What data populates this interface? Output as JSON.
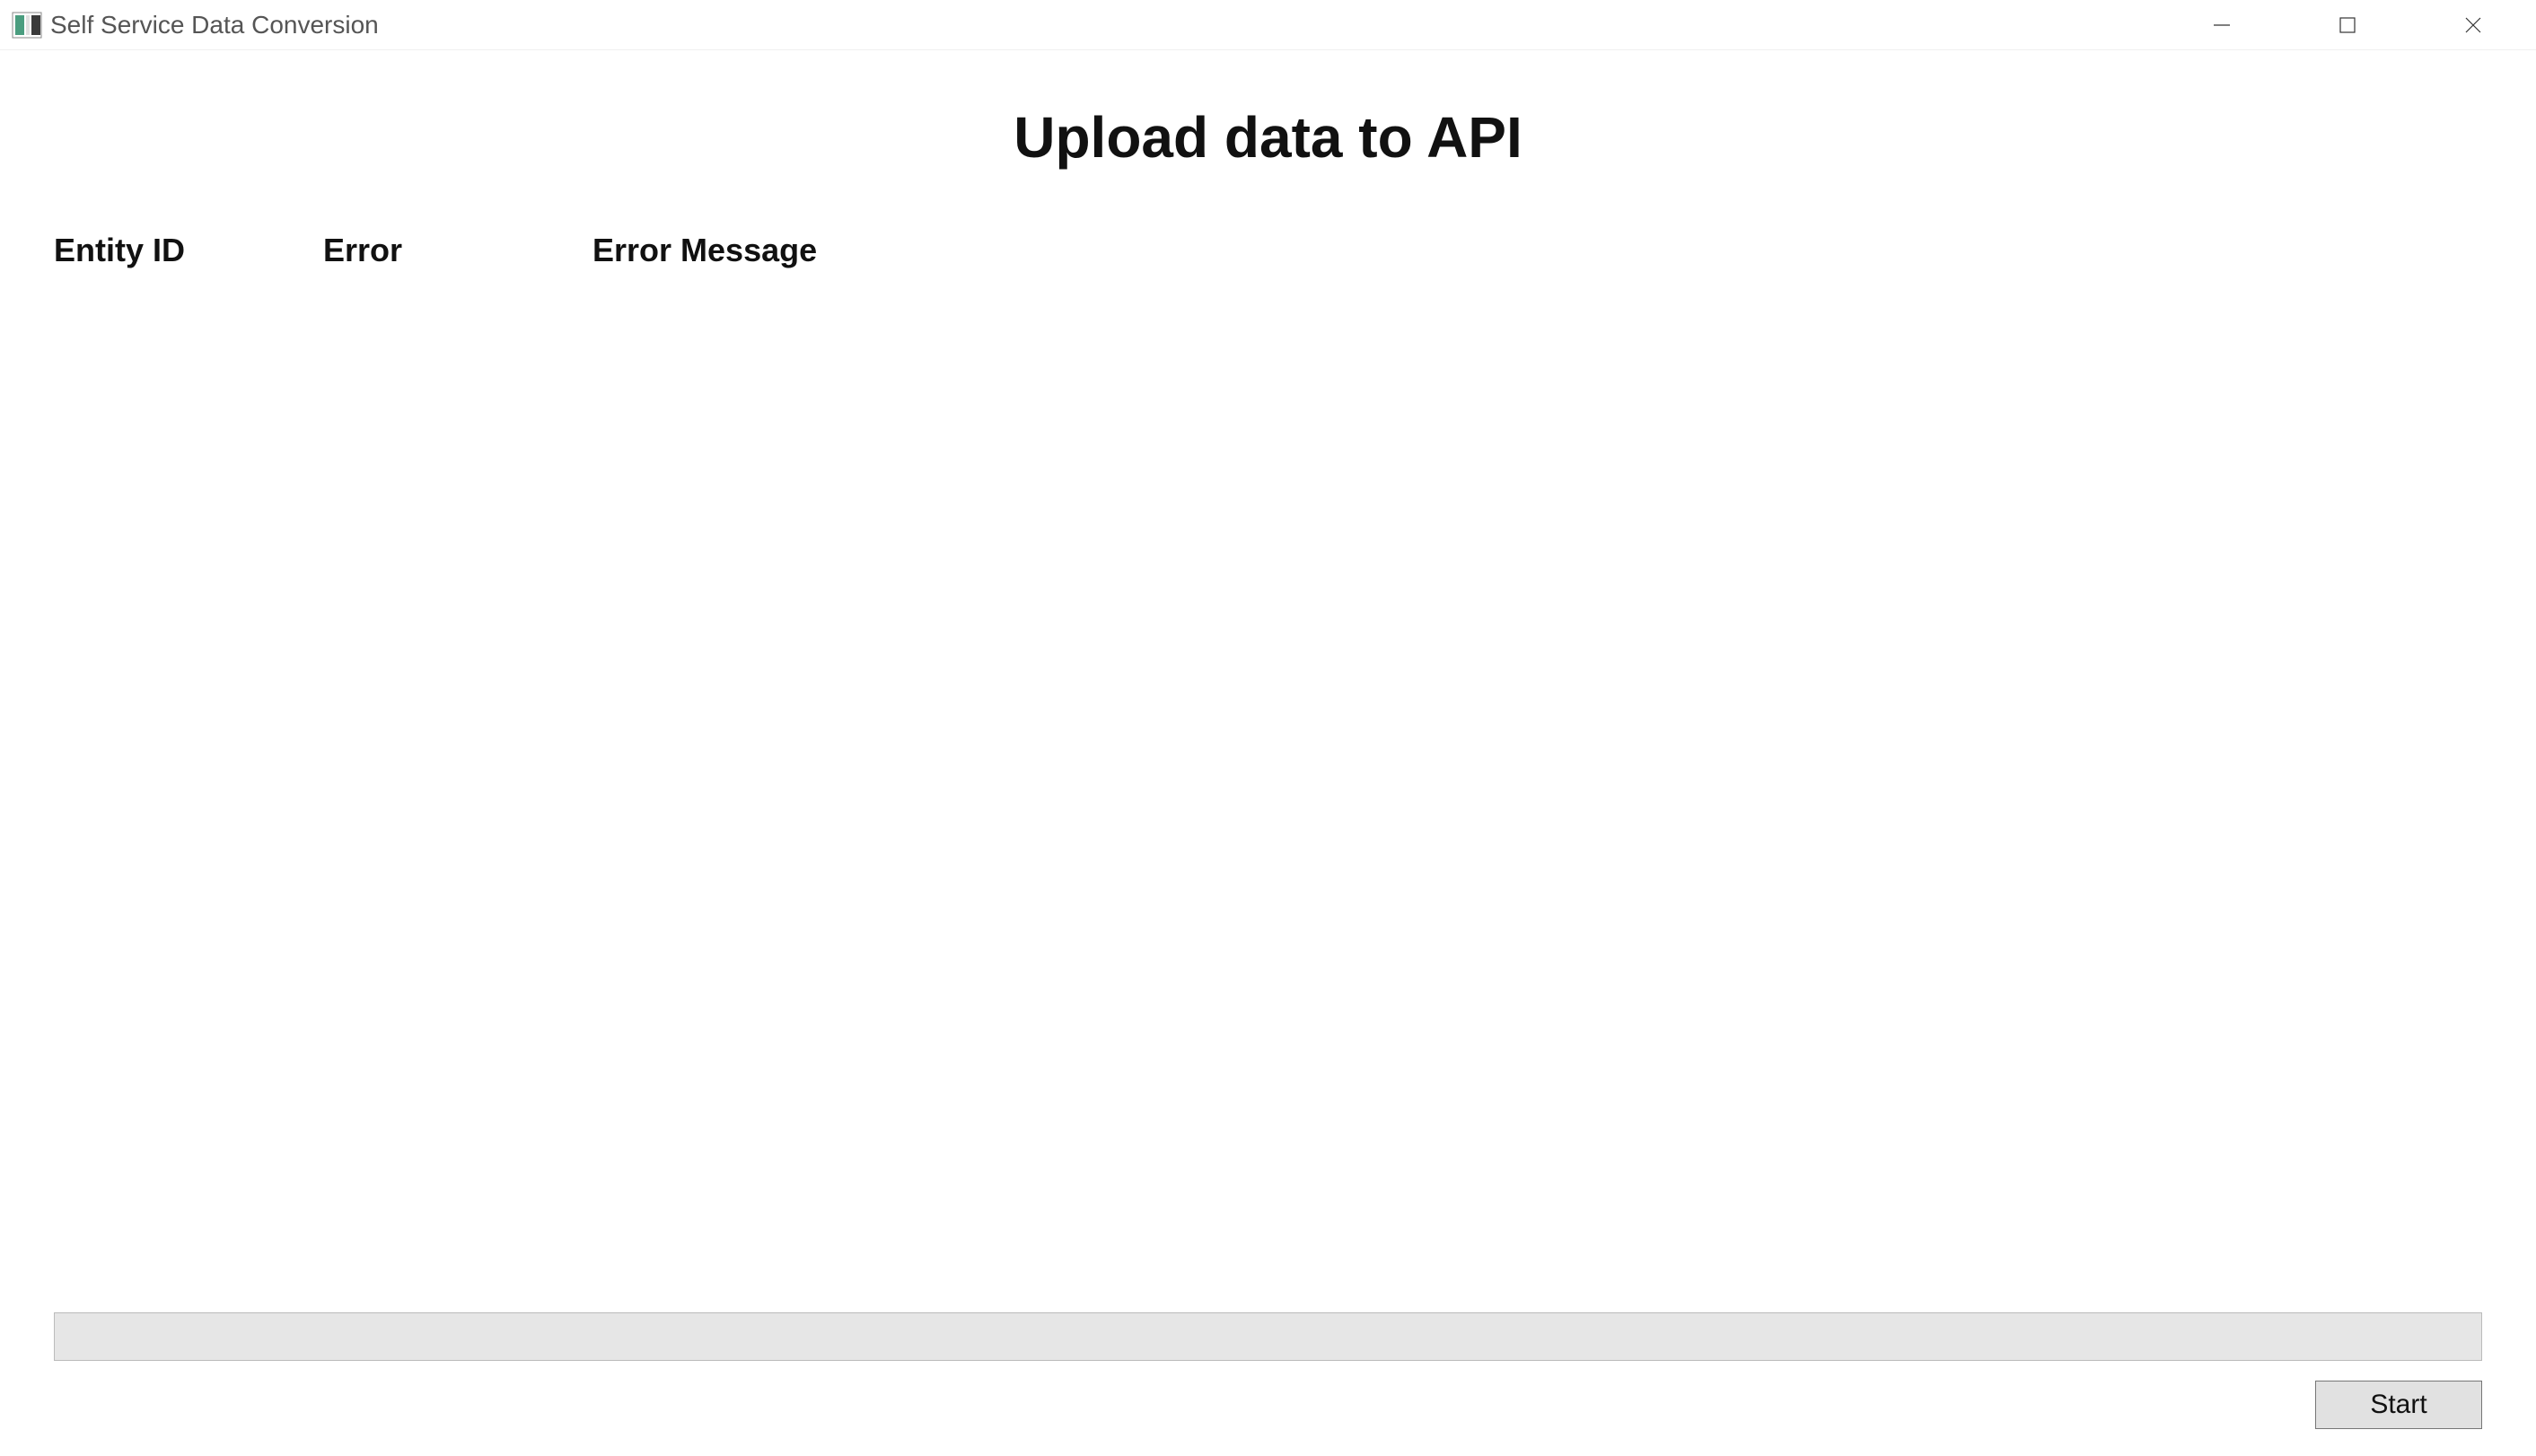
{
  "window": {
    "title": "Self Service Data Conversion"
  },
  "main": {
    "heading": "Upload data to API",
    "columns": {
      "entity_id": "Entity ID",
      "error": "Error",
      "error_message": "Error Message"
    }
  },
  "footer": {
    "start_label": "Start"
  }
}
